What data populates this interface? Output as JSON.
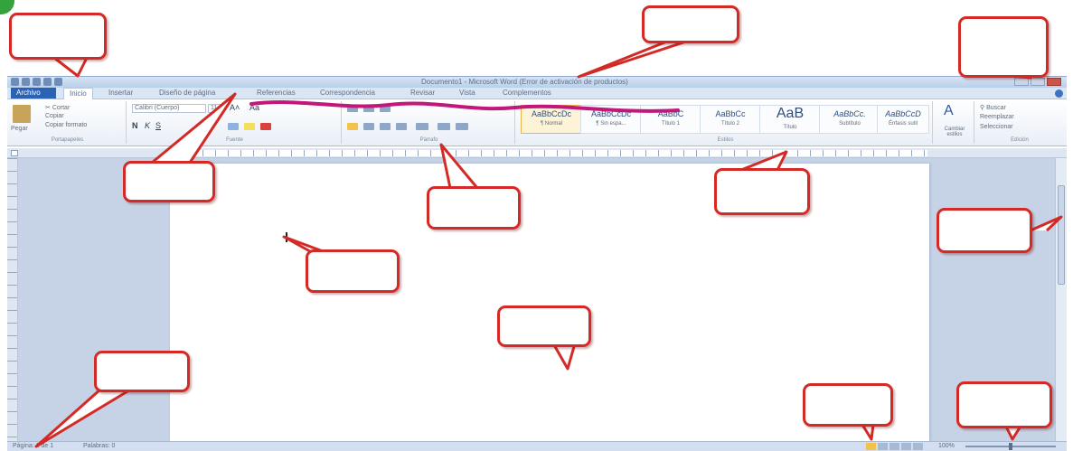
{
  "window": {
    "title": "Documento1 - Microsoft Word (Error de activación de productos)"
  },
  "tabs": [
    "Archivo",
    "Inicio",
    "Insertar",
    "Diseño de página",
    "Referencias",
    "Correspondencia",
    "Revisar",
    "Vista",
    "Complementos"
  ],
  "ribbon": {
    "clipboard": {
      "paste": "Pegar",
      "cut": "Cortar",
      "copy": "Copiar",
      "format_painter": "Copiar formato",
      "label": "Portapapeles"
    },
    "font": {
      "family": "Calibri (Cuerpo)",
      "size": "11",
      "label": "Fuente"
    },
    "paragraph": {
      "label": "Párrafo"
    },
    "styles": {
      "items": [
        {
          "sample": "AaBbCcDc",
          "name": "¶ Normal"
        },
        {
          "sample": "AaBbCcDc",
          "name": "¶ Sin espa..."
        },
        {
          "sample": "AaBbC",
          "name": "Título 1"
        },
        {
          "sample": "AaBbCc",
          "name": "Título 2"
        },
        {
          "sample": "AaB",
          "name": "Título"
        },
        {
          "sample": "AaBbCc.",
          "name": "Subtítulo"
        },
        {
          "sample": "AaBbCcD",
          "name": "Énfasis sutil"
        }
      ],
      "change_styles": "Cambiar estilos",
      "label": "Estilos"
    },
    "editing": {
      "find": "Buscar",
      "replace": "Reemplazar",
      "select": "Seleccionar",
      "label": "Edición"
    }
  },
  "status": {
    "page": "Página: 1 de 1",
    "words": "Palabras: 0",
    "zoom": "100%"
  },
  "colors": {
    "callout_border": "#d42a26",
    "underline": "#c2187c",
    "file_tab": "#2a63b6"
  }
}
